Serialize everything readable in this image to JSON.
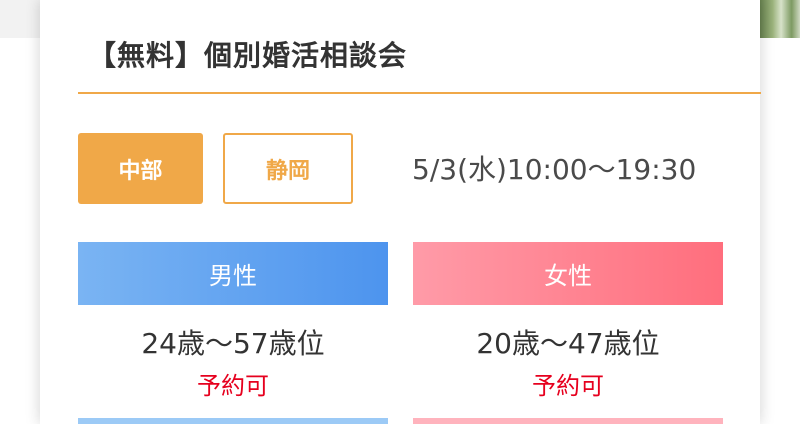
{
  "event": {
    "title": "【無料】個別婚活相談会",
    "regions": [
      {
        "label": "中部",
        "selected": true
      },
      {
        "label": "静岡",
        "selected": false
      }
    ],
    "datetime": "5/3(水)10:00〜19:30"
  },
  "groups": [
    {
      "gender": "男性",
      "age_range": "24歳〜57歳位",
      "status": "予約可",
      "color": "#4d94ee"
    },
    {
      "gender": "女性",
      "age_range": "20歳〜47歳位",
      "status": "予約可",
      "color": "#ff6e7d"
    }
  ],
  "colors": {
    "accent": "#f0a848",
    "status": "#e6001e"
  }
}
